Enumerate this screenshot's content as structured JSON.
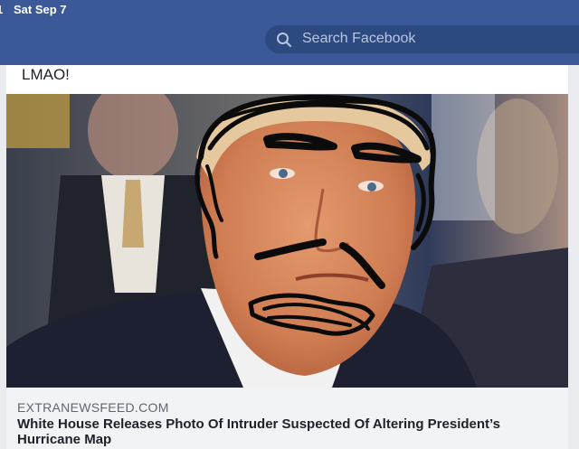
{
  "status_bar": {
    "time": "1",
    "date": "Sat Sep 7"
  },
  "search": {
    "placeholder": "Search Facebook"
  },
  "post": {
    "text": "LMAO!",
    "link": {
      "domain": "EXTRANEWSFEED.COM",
      "title": "White House Releases Photo Of Intruder Suspected Of Altering President’s Hurricane Map"
    }
  },
  "colors": {
    "header": "#3b5998",
    "search_field": "#2d4a80",
    "link_preview_bg": "#f2f3f5"
  },
  "icons": [
    "search-icon"
  ]
}
